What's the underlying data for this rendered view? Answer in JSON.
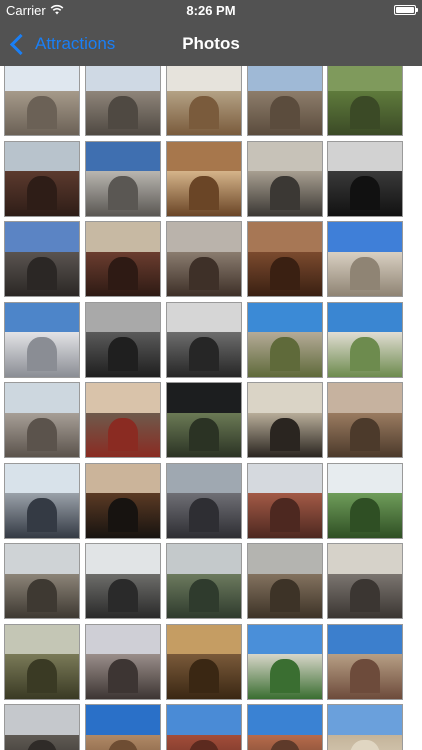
{
  "status_bar": {
    "carrier": "Carrier",
    "time": "8:26 PM",
    "wifi_icon": "wifi-icon",
    "battery_icon": "battery-icon",
    "battery_level": 1.0
  },
  "nav": {
    "back_label": "Attractions",
    "back_icon": "chevron-left-icon",
    "title": "Photos"
  },
  "colors": {
    "bar_background": "#525252",
    "accent": "#1a7ff5",
    "title_text": "#ffffff"
  },
  "photos": [
    {
      "sky": "#dfe7ef",
      "bld": "#a69a8a",
      "acc": "#6b6156"
    },
    {
      "sky": "#cfd9e4",
      "bld": "#8f857a",
      "acc": "#4f4942"
    },
    {
      "sky": "#e6e3dc",
      "bld": "#b4a285",
      "acc": "#7a5b3c"
    },
    {
      "sky": "#9fb9d6",
      "bld": "#8d7d6b",
      "acc": "#5b4c3d"
    },
    {
      "sky": "#7f9a5c",
      "bld": "#5f7b3c",
      "acc": "#3b4a26"
    },
    {
      "sky": "#b8c3cc",
      "bld": "#5c3a2e",
      "acc": "#2e1d17"
    },
    {
      "sky": "#3f6fb0",
      "bld": "#b9b6b0",
      "acc": "#5a5753"
    },
    {
      "sky": "#a7774c",
      "bld": "#d5b48a",
      "acc": "#6a4526"
    },
    {
      "sky": "#c7c2b8",
      "bld": "#a89f91",
      "acc": "#3b3834"
    },
    {
      "sky": "#d2d2d2",
      "bld": "#3a3a3a",
      "acc": "#111111"
    },
    {
      "sky": "#5b84c4",
      "bld": "#5a5450",
      "acc": "#2b2725"
    },
    {
      "sky": "#c7b9a3",
      "bld": "#6b3d2f",
      "acc": "#2e1a14"
    },
    {
      "sky": "#bab3ab",
      "bld": "#8a7c6f",
      "acc": "#3e3028"
    },
    {
      "sky": "#a77755",
      "bld": "#7b4a2e",
      "acc": "#3a2012"
    },
    {
      "sky": "#3f7fd8",
      "bld": "#d9d0c2",
      "acc": "#8f8474"
    },
    {
      "sky": "#4d85c9",
      "bld": "#e3e3e6",
      "acc": "#8a8d94"
    },
    {
      "sky": "#a9a9a9",
      "bld": "#5a5a5a",
      "acc": "#1f1f1f"
    },
    {
      "sky": "#d6d6d6",
      "bld": "#6d6d6d",
      "acc": "#262626"
    },
    {
      "sky": "#3b8ad6",
      "bld": "#b5ab98",
      "acc": "#5f6a3a"
    },
    {
      "sky": "#3a86d2",
      "bld": "#e1ddd3",
      "acc": "#6d8b4e"
    },
    {
      "sky": "#cdd7df",
      "bld": "#a79f97",
      "acc": "#5b534c"
    },
    {
      "sky": "#d9c3aa",
      "bld": "#6e5a4c",
      "acc": "#8a2b22"
    },
    {
      "sky": "#1c1e1f",
      "bld": "#6b7a55",
      "acc": "#2b3324"
    },
    {
      "sky": "#dad4c6",
      "bld": "#b8ad99",
      "acc": "#2a2520"
    },
    {
      "sky": "#c6b29f",
      "bld": "#9a7b60",
      "acc": "#4c3a2b"
    },
    {
      "sky": "#d8e2ea",
      "bld": "#9aa1a9",
      "acc": "#343a44"
    },
    {
      "sky": "#cbb49a",
      "bld": "#5b3a24",
      "acc": "#171310"
    },
    {
      "sky": "#9fa8b1",
      "bld": "#6f6f75",
      "acc": "#2e2e33"
    },
    {
      "sky": "#d5d9de",
      "bld": "#a35a46",
      "acc": "#4d2820"
    },
    {
      "sky": "#e7ecef",
      "bld": "#6f9d5a",
      "acc": "#2f4f24"
    },
    {
      "sky": "#cfd3d6",
      "bld": "#8c8478",
      "acc": "#3e3932"
    },
    {
      "sky": "#e1e4e6",
      "bld": "#6d6d6a",
      "acc": "#2a2a2a"
    },
    {
      "sky": "#c4c9cb",
      "bld": "#6c7a5e",
      "acc": "#2f3b2d"
    },
    {
      "sky": "#b4b4b0",
      "bld": "#83725f",
      "acc": "#3d3327"
    },
    {
      "sky": "#d6d2c9",
      "bld": "#7b7570",
      "acc": "#3b3632"
    },
    {
      "sky": "#c4c6b5",
      "bld": "#7a7a58",
      "acc": "#3a3a24"
    },
    {
      "sky": "#cfcfd6",
      "bld": "#9a8e8a",
      "acc": "#3d3533"
    },
    {
      "sky": "#c59d63",
      "bld": "#7a5a3a",
      "acc": "#3a2713"
    },
    {
      "sky": "#4a8fd9",
      "bld": "#d8d6c9",
      "acc": "#3a6e31"
    },
    {
      "sky": "#3c7fcd",
      "bld": "#b79f85",
      "acc": "#6d4b3b"
    },
    {
      "sky": "#c5c8cc",
      "bld": "#5f5a54",
      "acc": "#2f2b28"
    },
    {
      "sky": "#2a70c8",
      "bld": "#b08966",
      "acc": "#6e4d33"
    },
    {
      "sky": "#4a8bd6",
      "bld": "#a34d3a",
      "acc": "#5c2a1f"
    },
    {
      "sky": "#3a82d3",
      "bld": "#b76b4b",
      "acc": "#5e3a2a"
    },
    {
      "sky": "#6aa0dc",
      "bld": "#c4b49a",
      "acc": "#e0d6c2"
    }
  ]
}
